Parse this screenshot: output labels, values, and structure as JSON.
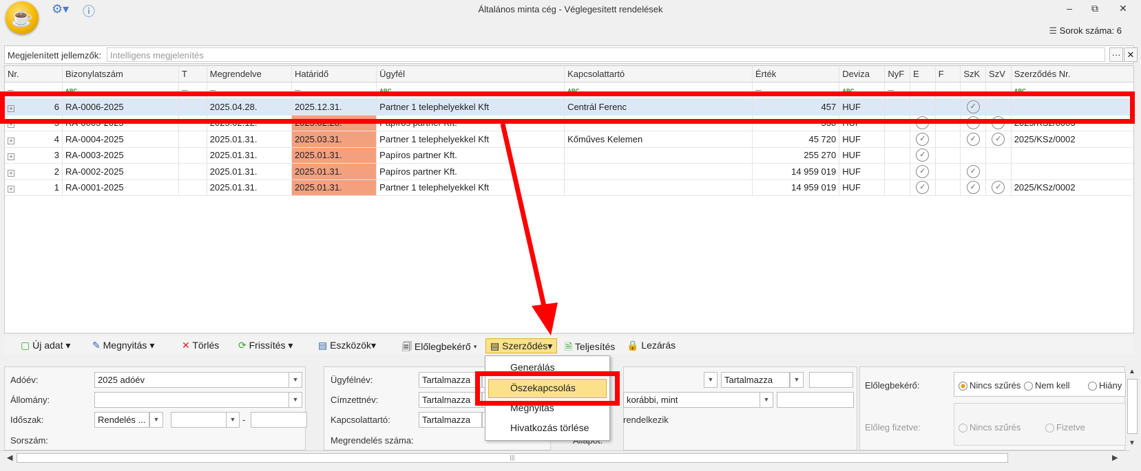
{
  "window": {
    "title": "Általános minta cég - Véglegesített rendelések",
    "minimize": "▭",
    "restore": "⧉",
    "close": "✕"
  },
  "rowcount": "Sorok száma: 6",
  "filter": {
    "label": "Megjelenített jellemzők:",
    "placeholder": "Intelligens megjelenítés",
    "more": "···",
    "clear": "✕"
  },
  "columns": [
    "Nr.",
    "Bizonylatszám",
    "T",
    "Megrendelve",
    "Határidő",
    "Ügyfél",
    "Kapcsolattartó",
    "Érték",
    "Deviza",
    "NyF",
    "E",
    "F",
    "SzK",
    "SzV",
    "Szerződés Nr."
  ],
  "rows": [
    {
      "nr": "6",
      "biz": "RA-0006-2025",
      "meg": "2025.04.28.",
      "hat": "2025.12.31.",
      "ugy": "Partner 1 telephelyekkel Kft",
      "kap": "Centrál Ferenc",
      "ert": "457",
      "dev": "HUF",
      "e": false,
      "szk": true,
      "szv": false,
      "szerz": ""
    },
    {
      "nr": "5",
      "biz": "RA-0005-2025",
      "meg": "2025.02.12.",
      "hat": "2025.02.28.",
      "ugy": "Papíros partner Kft.",
      "kap": "",
      "ert": "538",
      "dev": "HUF",
      "e": true,
      "szk": true,
      "szv": true,
      "szerz": "2025/KSz/0003"
    },
    {
      "nr": "4",
      "biz": "RA-0004-2025",
      "meg": "2025.01.31.",
      "hat": "2025.03.31.",
      "ugy": "Partner 1 telephelyekkel Kft",
      "kap": "Kőműves Kelemen",
      "ert": "45 720",
      "dev": "HUF",
      "e": true,
      "szk": true,
      "szv": true,
      "szerz": "2025/KSz/0002"
    },
    {
      "nr": "3",
      "biz": "RA-0003-2025",
      "meg": "2025.01.31.",
      "hat": "2025.01.31.",
      "ugy": "Papíros partner Kft.",
      "kap": "",
      "ert": "255 270",
      "dev": "HUF",
      "e": true,
      "szk": false,
      "szv": false,
      "szerz": ""
    },
    {
      "nr": "2",
      "biz": "RA-0002-2025",
      "meg": "2025.01.31.",
      "hat": "2025.01.31.",
      "ugy": "Papíros partner Kft.",
      "kap": "",
      "ert": "14 959 019",
      "dev": "HUF",
      "e": true,
      "szk": true,
      "szv": false,
      "szerz": ""
    },
    {
      "nr": "1",
      "biz": "RA-0001-2025",
      "meg": "2025.01.31.",
      "hat": "2025.01.31.",
      "ugy": "Partner 1 telephelyekkel Kft",
      "kap": "",
      "ert": "14 959 019",
      "dev": "HUF",
      "e": true,
      "szk": true,
      "szv": true,
      "szerz": "2025/KSz/0002"
    }
  ],
  "toolbar": {
    "new": "Új adat",
    "open": "Megnyitás",
    "delete": "Törlés",
    "refresh": "Frissítés",
    "tools": "Eszközök",
    "advance": "Előlegbekérő",
    "contract": "Szerződés",
    "fulfil": "Teljesítés",
    "close": "Lezárás"
  },
  "menu": {
    "generate": "Generálás",
    "link": "Öszekapcsolás",
    "open": "Megnyitás",
    "removeref": "Hivatkozás törlése"
  },
  "form": {
    "adoev_label": "Adóév:",
    "adoev_value": "2025 adóév",
    "allomany_label": "Állomány:",
    "idoszak_label": "Időszak:",
    "idoszak_value": "Rendelés ...",
    "dash": "-",
    "sorszam_label": "Sorszám:",
    "ugyfelnev_label": "Ügyfélnév:",
    "cimzett_label": "Címzettnév:",
    "kapcs_label": "Kapcsolattartó:",
    "megrszam_label": "Megrendelés száma:",
    "tartalmazza": "Tartalmazza",
    "korabbi": "korábbi, mint",
    "rendelkezik": "rendelkezik",
    "allapot_label": "Állapot:",
    "elolegbekero_label": "Előlegbekérő:",
    "nincs": "Nincs szűrés",
    "nemkell": "Nem kell",
    "hiany": "Hiány",
    "elolegfiz_label": "Előleg fizetve:",
    "fizetve": "Fizetve"
  }
}
